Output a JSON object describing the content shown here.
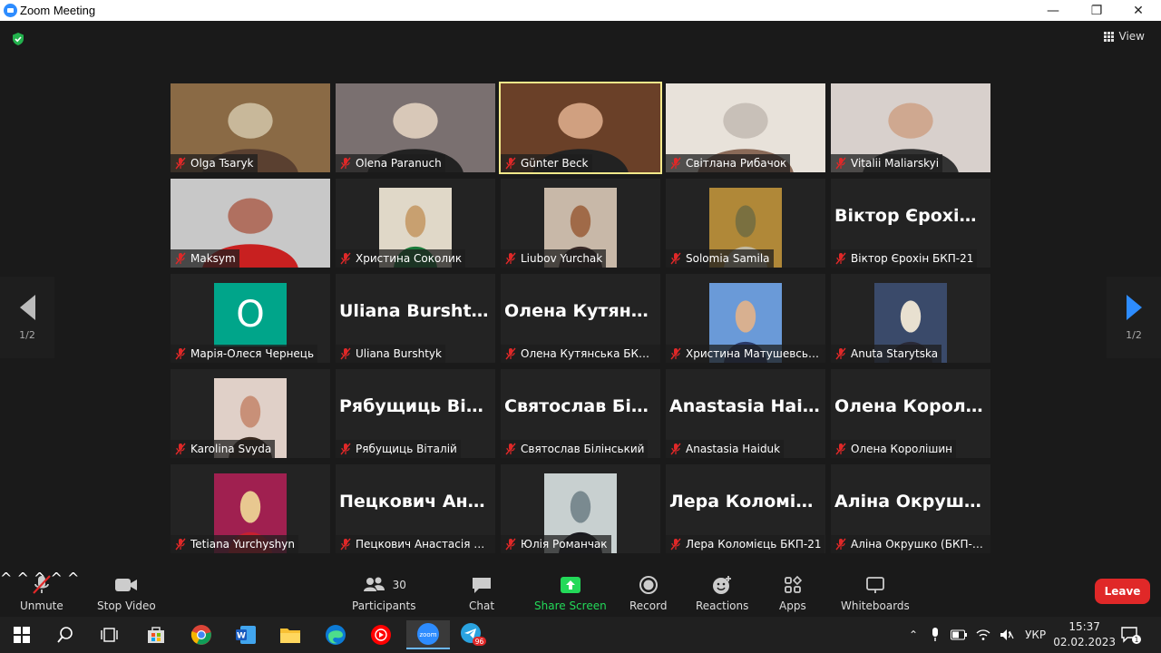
{
  "window": {
    "title": "Zoom Meeting",
    "minimize": "—",
    "maximize": "❐",
    "close": "✕"
  },
  "header": {
    "view_label": "View"
  },
  "pager": {
    "left_page": "1/2",
    "right_page": "1/2"
  },
  "participants": [
    {
      "name": "Olga Tsaryk",
      "type": "video",
      "colors": [
        "#8a6a45",
        "#c8b89a",
        "#5a4030"
      ]
    },
    {
      "name": "Olena Paranuch",
      "type": "video",
      "colors": [
        "#7a7070",
        "#d8c8b8",
        "#222"
      ]
    },
    {
      "name": "Günter Beck",
      "type": "video",
      "active": true,
      "colors": [
        "#6a4028",
        "#d0a080",
        "#222"
      ]
    },
    {
      "name": "Світлана Рибачок",
      "type": "video",
      "colors": [
        "#e8e2da",
        "#c8c0b8",
        "#8a6a58"
      ]
    },
    {
      "name": "Vitalii Maliarskyi",
      "type": "video",
      "colors": [
        "#d8d0cc",
        "#cfa890",
        "#333"
      ]
    },
    {
      "name": "Maksym",
      "type": "video",
      "colors": [
        "#c8c8c8",
        "#b07060",
        "#c82020"
      ]
    },
    {
      "name": "Христина Соколик",
      "type": "video",
      "colors": [
        "#e0d8c8",
        "#c8a070",
        "#1a7a3a"
      ],
      "inset": true
    },
    {
      "name": "Liubov Yurchak",
      "type": "video",
      "colors": [
        "#c8b8a8",
        "#a06a48",
        "#3a2a28"
      ],
      "inset": true
    },
    {
      "name": "Solomia Samila",
      "type": "video",
      "colors": [
        "#b08838",
        "#7a7040",
        "#c0b8a0"
      ],
      "inset": true
    },
    {
      "name": "Віктор Єрохін БКП-21",
      "type": "name",
      "bigname": "Віктор Єрохін..."
    },
    {
      "name": "Марія-Олеся Чернець",
      "type": "avatar",
      "initial": "O"
    },
    {
      "name": "Uliana Burshtyk",
      "type": "name",
      "bigname": "Uliana Burshtyk"
    },
    {
      "name": "Олена Кутянська БКП-21",
      "type": "name",
      "bigname": "Олена Кутянсь..."
    },
    {
      "name": "Христина Матушевська (...",
      "type": "video",
      "colors": [
        "#6a9ad8",
        "#d8b090",
        "#2a3a6a"
      ],
      "inset": true
    },
    {
      "name": "Anuta Starytska",
      "type": "video",
      "colors": [
        "#3a4a6a",
        "#e8e0d0",
        "#2a2a38"
      ],
      "inset": true
    },
    {
      "name": "Karolina Svyda",
      "type": "video",
      "colors": [
        "#e0d0c8",
        "#c89078",
        "#3a2a20"
      ],
      "inset": true
    },
    {
      "name": "Рябущиць Віталій",
      "type": "name",
      "bigname": "Рябущиць Віта..."
    },
    {
      "name": "Святослав Білінський",
      "type": "name",
      "bigname": "Святослав Білі..."
    },
    {
      "name": "Anastasia Haiduk",
      "type": "name",
      "bigname": "Anastasia Haiduk"
    },
    {
      "name": "Олена Королішин",
      "type": "name",
      "bigname": "Олена Королі..."
    },
    {
      "name": "Tetiana Yurchyshyn",
      "type": "video",
      "colors": [
        "#a02050",
        "#e8c890",
        "#c82030"
      ],
      "inset": true
    },
    {
      "name": "Пецкович Анастасія БК...",
      "type": "name",
      "bigname": "Пецкович Анас..."
    },
    {
      "name": "Юлія Романчак",
      "type": "video",
      "colors": [
        "#c8d0d0",
        "#7a8a90",
        "#1a1a20"
      ],
      "inset": true
    },
    {
      "name": "Лера Коломієць БКП-21",
      "type": "name",
      "bigname": "Лера Коломієц..."
    },
    {
      "name": "Аліна Окрушко (БКП-21)",
      "type": "name",
      "bigname": "Аліна Окрушк..."
    }
  ],
  "toolbar": {
    "unmute": "Unmute",
    "stop_video": "Stop Video",
    "participants": "Participants",
    "participants_count": "30",
    "chat": "Chat",
    "share_screen": "Share Screen",
    "record": "Record",
    "reactions": "Reactions",
    "apps": "Apps",
    "whiteboards": "Whiteboards",
    "leave": "Leave",
    "caret": "^"
  },
  "taskbar": {
    "language": "УКР",
    "time": "15:37",
    "date": "02.02.2023",
    "telegram_badge": "96",
    "notification_badge": "1",
    "zoom_label": "zoom",
    "word_label": "W"
  },
  "colors": {
    "accent": "#2d8cff",
    "active_speaker": "#f3e98a",
    "share_green": "#23d959",
    "leave_red": "#e02828",
    "muted_mic": "#e02828"
  }
}
